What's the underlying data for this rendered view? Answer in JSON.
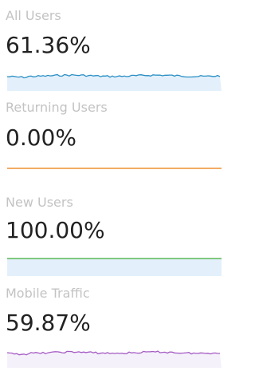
{
  "metrics": [
    {
      "label": "All Users",
      "value": "61.36%",
      "series_color": "#2b8fc4",
      "fill_color": "#e3f0fb"
    },
    {
      "label": "Returning Users",
      "value": "0.00%",
      "series_color": "#f0a04e",
      "fill_color": "#ffffff"
    },
    {
      "label": "New Users",
      "value": "100.00%",
      "series_color": "#6fc26d",
      "fill_color": "#e3f0fb"
    },
    {
      "label": "Mobile Traffic",
      "value": "59.87%",
      "series_color": "#a55bc4",
      "fill_color": "#f4f1fa"
    }
  ]
}
